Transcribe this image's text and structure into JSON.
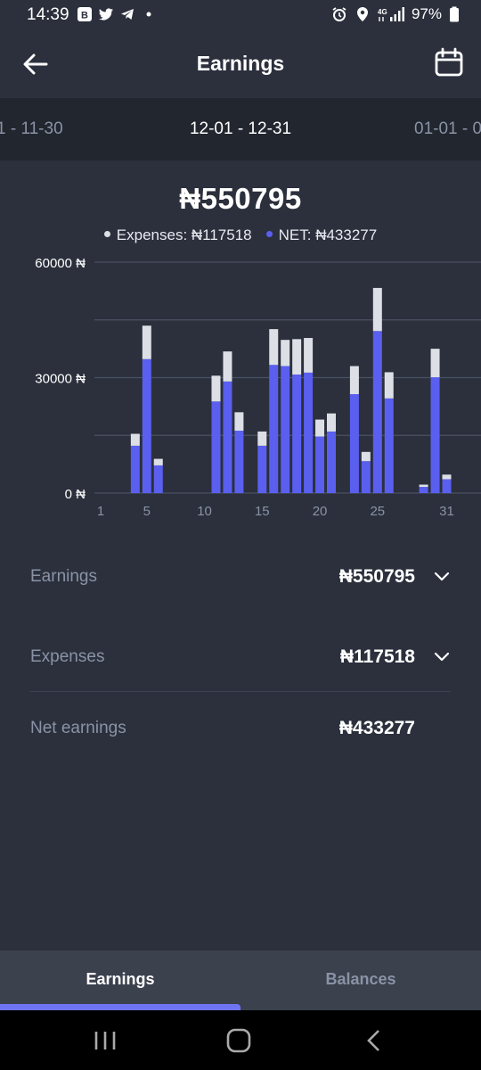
{
  "status_bar": {
    "time": "14:39",
    "battery": "97%"
  },
  "header": {
    "title": "Earnings"
  },
  "periods": {
    "previous": "1 - 11-30",
    "current": "12-01 - 12-31",
    "next": "01-01 - 0"
  },
  "summary": {
    "total": "₦550795",
    "expenses_legend": "Expenses: ₦117518",
    "net_legend": "NET: ₦433277"
  },
  "colors": {
    "net": "#5a5ff0",
    "expenses": "#dcdfe5",
    "background": "#2b303c",
    "accent": "#6f75f2"
  },
  "chart_data": {
    "type": "bar",
    "stacked": true,
    "x": [
      1,
      2,
      3,
      4,
      5,
      6,
      7,
      8,
      9,
      10,
      11,
      12,
      13,
      14,
      15,
      16,
      17,
      18,
      19,
      20,
      21,
      22,
      23,
      24,
      25,
      26,
      27,
      28,
      29,
      30,
      31
    ],
    "series": [
      {
        "name": "NET",
        "values": [
          0,
          0,
          0,
          12300,
          34800,
          7200,
          0,
          0,
          0,
          0,
          23800,
          29000,
          16200,
          0,
          12300,
          33300,
          33000,
          30800,
          31300,
          14700,
          16000,
          0,
          25700,
          8300,
          42100,
          24600,
          0,
          0,
          1600,
          30100,
          3600
        ]
      },
      {
        "name": "Expenses",
        "values": [
          0,
          0,
          0,
          3100,
          8700,
          1700,
          0,
          0,
          0,
          0,
          6700,
          7800,
          4800,
          0,
          3700,
          9300,
          6800,
          9200,
          9000,
          4400,
          4700,
          0,
          7300,
          2400,
          11200,
          6800,
          0,
          0,
          600,
          7400,
          1200
        ]
      }
    ],
    "y_ticks": [
      "60000 ₦",
      "30000 ₦",
      "0 ₦"
    ],
    "x_ticks": [
      "1",
      "5",
      "10",
      "15",
      "20",
      "25",
      "31"
    ],
    "ylim": [
      0,
      60000
    ],
    "grid": true
  },
  "details": {
    "earnings": {
      "label": "Earnings",
      "value": "₦550795"
    },
    "expenses": {
      "label": "Expenses",
      "value": "₦117518"
    },
    "net": {
      "label": "Net earnings",
      "value": "₦433277"
    }
  },
  "bottom_nav": {
    "tabs": [
      {
        "label": "Earnings"
      },
      {
        "label": "Balances"
      }
    ]
  }
}
